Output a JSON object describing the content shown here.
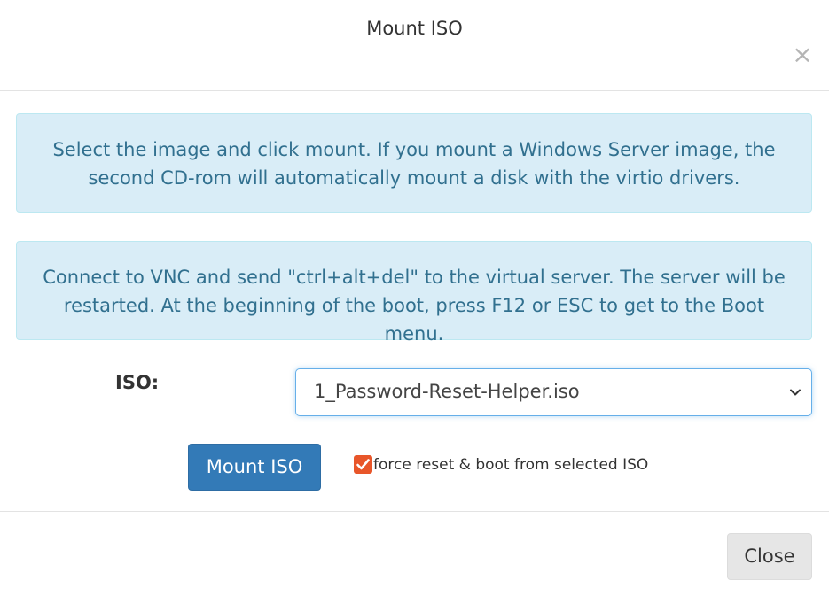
{
  "modal": {
    "title": "Mount ISO",
    "close_symbol": "×"
  },
  "alerts": [
    {
      "text": "Select the image and click mount. If you mount a Windows Server image, the second CD-rom will automatically mount a disk with the virtio drivers."
    },
    {
      "text": "Connect to VNC and send \"ctrl+alt+del\" to the virtual server. The server will be restarted. At the beginning of the boot, press F12 or ESC to get to the Boot menu."
    }
  ],
  "form": {
    "iso_label": "ISO:",
    "iso_selected": "1_Password-Reset-Helper.iso",
    "mount_button_label": "Mount ISO",
    "force_checkbox_checked": true,
    "force_checkbox_label": "force reset & boot from selected ISO"
  },
  "footer": {
    "close_button_label": "Close"
  },
  "colors": {
    "alert_bg": "#d9edf7",
    "alert_text": "#31708f",
    "primary": "#337ab7",
    "checkbox": "#e8562a"
  },
  "icons": {
    "close": "close-icon",
    "dropdown": "chevron-down-icon",
    "check": "check-icon"
  }
}
